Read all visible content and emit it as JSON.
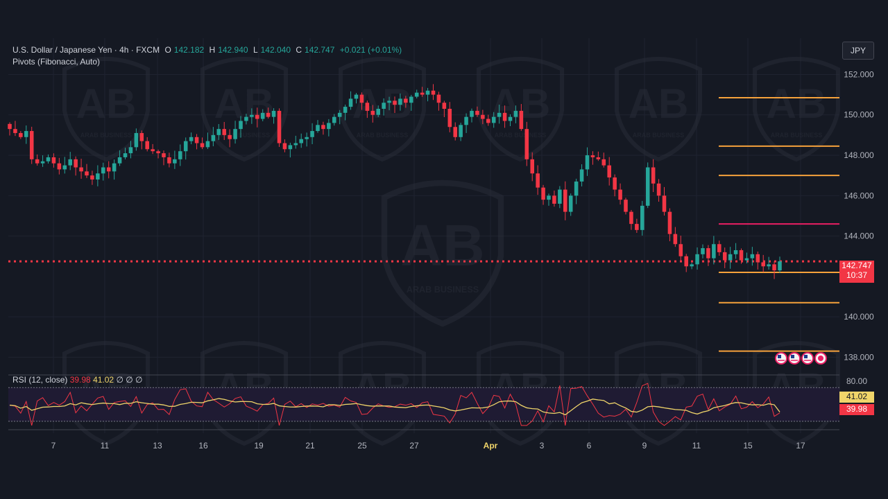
{
  "header": {
    "symbol": "U.S. Dollar / Japanese Yen · 4h · FXCM",
    "o_label": "O",
    "o_value": "142.182",
    "h_label": "H",
    "h_value": "142.940",
    "l_label": "L",
    "l_value": "142.040",
    "c_label": "C",
    "c_value": "142.747",
    "change": "+0.021 (+0.01%)",
    "indicator": "Pivots (Fibonacci, Auto)"
  },
  "currency_button": "JPY",
  "watermark_text": "ARAB BUSINESS",
  "rsi": {
    "label": "RSI (12, close)",
    "value1": "39.98",
    "value2": "41.02",
    "extra": "∅  ∅  ∅",
    "upper_tick": "80.00",
    "badge_ma": "41.02",
    "badge_rsi": "39.98"
  },
  "price_badge": {
    "price": "142.747",
    "countdown": "10:37"
  },
  "colors": {
    "up": "#26a69a",
    "down": "#f23645",
    "pivot": "#f7a23b",
    "pivot_p": "#e91e63",
    "rsi_line": "#f23645",
    "rsi_ma": "#f0d56a",
    "bg": "#151923"
  },
  "chart_data": {
    "type": "candlestick",
    "title": "U.S. Dollar / Japanese Yen · 4h · FXCM",
    "ylim": [
      137.5,
      153.8
    ],
    "y_ticks": [
      {
        "value": 152,
        "label": "152.000"
      },
      {
        "value": 150,
        "label": "150.000"
      },
      {
        "value": 148,
        "label": "148.000"
      },
      {
        "value": 146,
        "label": "146.000"
      },
      {
        "value": 144,
        "label": "144.000"
      },
      {
        "value": 140,
        "label": "140.000"
      },
      {
        "value": 138,
        "label": "138.000"
      }
    ],
    "x_ticks": [
      "7",
      "11",
      "13",
      "16",
      "19",
      "21",
      "25",
      "27",
      "Apr",
      "3",
      "6",
      "9",
      "11",
      "15",
      "17"
    ],
    "close_series": [
      149.3,
      149.1,
      148.9,
      149.2,
      147.8,
      147.6,
      147.7,
      147.9,
      147.6,
      147.3,
      147.5,
      147.8,
      147.4,
      147.2,
      147.0,
      146.8,
      147.1,
      147.4,
      147.2,
      147.6,
      147.9,
      148.1,
      148.4,
      149.1,
      148.7,
      148.3,
      148.2,
      148.1,
      147.9,
      147.6,
      147.8,
      148.2,
      148.7,
      148.9,
      148.6,
      148.4,
      148.7,
      149.0,
      149.3,
      149.0,
      148.8,
      149.3,
      149.7,
      149.9,
      150.0,
      149.8,
      150.1,
      149.9,
      150.2,
      148.6,
      148.3,
      148.5,
      148.6,
      148.8,
      148.9,
      149.2,
      149.5,
      149.3,
      149.6,
      149.9,
      150.1,
      150.4,
      150.8,
      151.0,
      150.6,
      150.2,
      150.0,
      150.3,
      150.6,
      150.7,
      150.5,
      150.8,
      150.6,
      150.9,
      151.1,
      151.0,
      151.2,
      151.0,
      150.6,
      150.3,
      149.4,
      148.9,
      149.5,
      149.9,
      150.2,
      150.0,
      149.8,
      149.6,
      149.9,
      150.1,
      149.7,
      149.9,
      150.2,
      149.3,
      147.8,
      147.1,
      146.4,
      145.8,
      146.0,
      145.6,
      146.3,
      145.2,
      146.0,
      146.7,
      147.3,
      148.0,
      147.9,
      147.8,
      147.5,
      146.9,
      146.3,
      145.8,
      145.2,
      144.6,
      144.3,
      145.5,
      147.4,
      146.6,
      146.0,
      145.2,
      144.1,
      143.6,
      143.0,
      142.5,
      142.6,
      143.1,
      143.4,
      142.9,
      143.6,
      143.2,
      142.8,
      143.1,
      143.3,
      142.8,
      142.9,
      143.1,
      142.7,
      142.5,
      142.6,
      142.3,
      142.747
    ],
    "pivots": [
      {
        "name": "R3",
        "value": 150.85
      },
      {
        "name": "R2",
        "value": 148.45
      },
      {
        "name": "R1",
        "value": 147.0
      },
      {
        "name": "P",
        "value": 144.6
      },
      {
        "name": "S1",
        "value": 142.2
      },
      {
        "name": "S2",
        "value": 140.7
      },
      {
        "name": "S3",
        "value": 138.3
      }
    ],
    "last_price": 142.747,
    "rsi_panel": {
      "label": "RSI (12, close)",
      "ylim": [
        20,
        85
      ],
      "upper_band": 70,
      "lower_band": 30,
      "rsi_last": 39.98,
      "ma_last": 41.02
    }
  }
}
